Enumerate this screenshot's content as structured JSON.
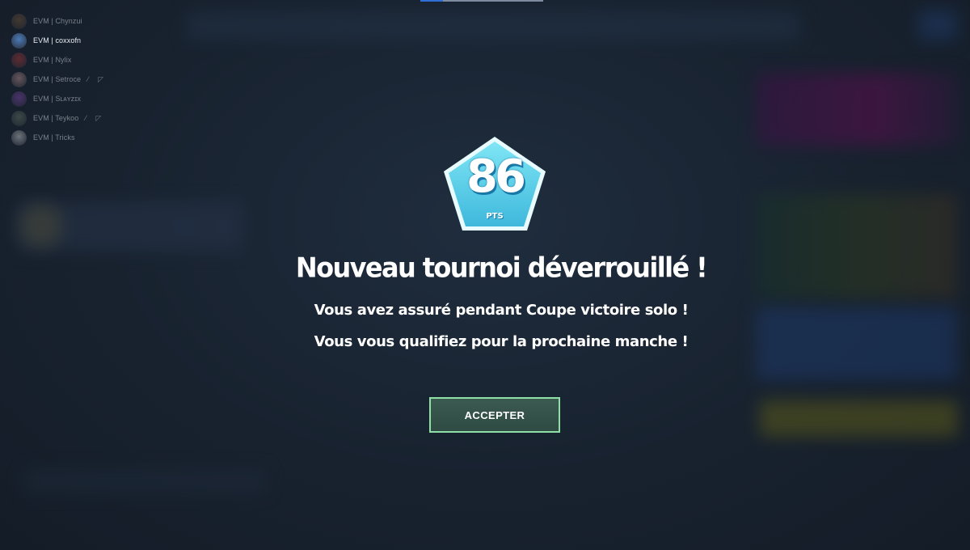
{
  "party": {
    "members": [
      {
        "name": "EVM | Chynzui",
        "active": false,
        "avatar_color": "#7a5a3a",
        "icons": []
      },
      {
        "name": "EVM | coxxofn",
        "active": true,
        "avatar_color": "#4a7ab8",
        "icons": []
      },
      {
        "name": "EVM | Nylix",
        "active": false,
        "avatar_color": "#b83a3a",
        "icons": []
      },
      {
        "name": "EVM | Setroce",
        "active": false,
        "avatar_color": "#c89a9a",
        "icons": [
          "muted-mic-icon",
          "muted-speaker-icon"
        ]
      },
      {
        "name": "EVM | Sʟᴀʏᴢɪx",
        "active": false,
        "avatar_color": "#8a4ab8",
        "icons": []
      },
      {
        "name": "EVM | Teykoo",
        "active": false,
        "avatar_color": "#6a7a6a",
        "icons": [
          "muted-mic-icon",
          "muted-speaker-icon"
        ]
      },
      {
        "name": "EVM | Tricks",
        "active": false,
        "avatar_color": "#d8d8d8",
        "icons": []
      }
    ]
  },
  "reward": {
    "points": "86",
    "unit": "PTS",
    "badge_color": "#5ad6ee"
  },
  "dialog": {
    "title": "Nouveau tournoi déverrouillé !",
    "line1": "Vous avez assuré pendant Coupe victoire solo !",
    "line2": "Vous vous qualifiez pour la prochaine manche !",
    "accept_label": "ACCEPTER"
  },
  "colors": {
    "background": "#1a2433",
    "accept_border": "#8fe0a6",
    "accept_fill": "#355249"
  }
}
